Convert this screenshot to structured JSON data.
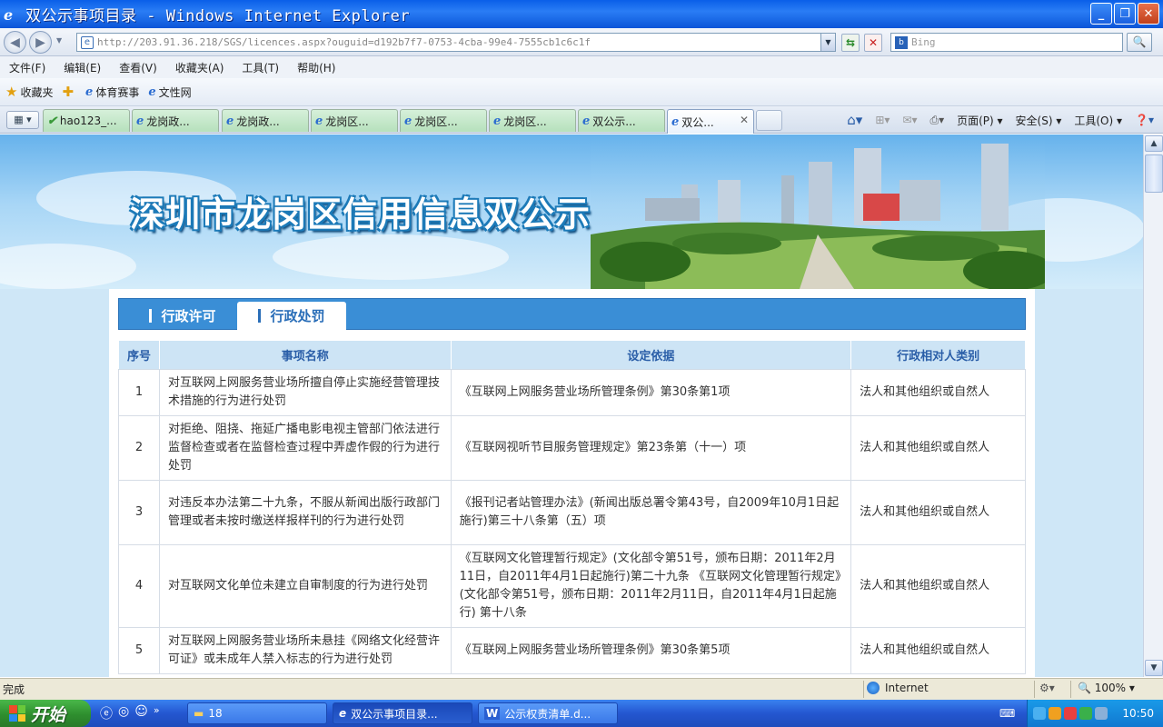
{
  "window": {
    "title": "双公示事项目录 - Windows Internet Explorer"
  },
  "address": {
    "url": "http://203.91.36.218/SGS/licences.aspx?ouguid=d192b7f7-0753-4cba-99e4-7555cb1c6c1f",
    "search_placeholder": "Bing"
  },
  "menu": [
    "文件(F)",
    "编辑(E)",
    "查看(V)",
    "收藏夹(A)",
    "工具(T)",
    "帮助(H)"
  ],
  "favorites": {
    "label": "收藏夹",
    "items": [
      "体育赛事",
      "文性网"
    ]
  },
  "tabs": [
    "hao123_...",
    "龙岗政...",
    "龙岗政...",
    "龙岗区...",
    "龙岗区...",
    "龙岗区...",
    "双公示...",
    "双公..."
  ],
  "commandbar": {
    "page": "页面(P)",
    "safety": "安全(S)",
    "tools": "工具(O)"
  },
  "banner": {
    "title": "深圳市龙岗区信用信息双公示"
  },
  "panel_tabs": {
    "license": "行政许可",
    "penalty": "行政处罚"
  },
  "table": {
    "headers": [
      "序号",
      "事项名称",
      "设定依据",
      "行政相对人类别"
    ],
    "rows": [
      {
        "no": "1",
        "name": "对互联网上网服务营业场所擅自停止实施经营管理技术措施的行为进行处罚",
        "basis": "《互联网上网服务营业场所管理条例》第30条第1项",
        "category": "法人和其他组织或自然人"
      },
      {
        "no": "2",
        "name": "对拒绝、阻挠、拖延广播电影电视主管部门依法进行监督检查或者在监督检查过程中弄虚作假的行为进行处罚",
        "basis": "《互联网视听节目服务管理规定》第23条第（十一）项",
        "category": "法人和其他组织或自然人"
      },
      {
        "no": "3",
        "name": "对违反本办法第二十九条，不服从新闻出版行政部门管理或者未按时缴送样报样刊的行为进行处罚",
        "basis": "《报刊记者站管理办法》(新闻出版总署令第43号，自2009年10月1日起施行)第三十八条第（五）项",
        "category": "法人和其他组织或自然人"
      },
      {
        "no": "4",
        "name": "对互联网文化单位未建立自审制度的行为进行处罚",
        "basis": "《互联网文化管理暂行规定》(文化部令第51号，颁布日期：2011年2月11日，自2011年4月1日起施行)第二十九条 《互联网文化管理暂行规定》(文化部令第51号，颁布日期：2011年2月11日，自2011年4月1日起施行) 第十八条",
        "category": "法人和其他组织或自然人"
      },
      {
        "no": "5",
        "name": "对互联网上网服务营业场所未悬挂《网络文化经营许可证》或未成年人禁入标志的行为进行处罚",
        "basis": "《互联网上网服务营业场所管理条例》第30条第5项",
        "category": "法人和其他组织或自然人"
      }
    ]
  },
  "status": {
    "text": "完成",
    "zone": "Internet",
    "zoom": "100%"
  },
  "taskbar": {
    "start": "开始",
    "folder": "18",
    "ie_window": "双公示事项目录...",
    "word_doc": "公示权责清单.d...",
    "clock": "10:50"
  }
}
